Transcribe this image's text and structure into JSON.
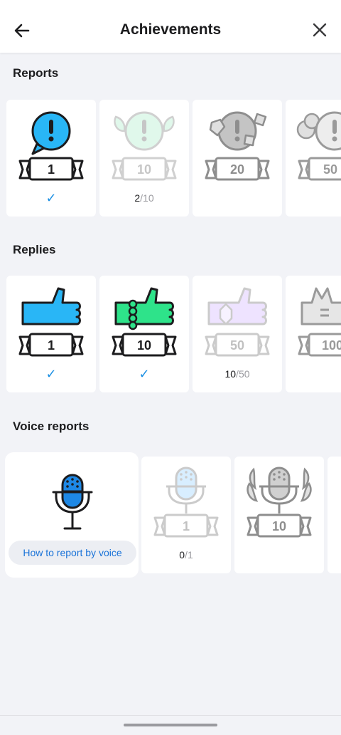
{
  "header": {
    "title": "Achievements",
    "back_icon": "arrow-left-icon",
    "close_icon": "close-icon"
  },
  "sections": [
    {
      "title": "Reports",
      "cards": [
        {
          "badge": "1",
          "state": "done",
          "icon": "speech-bubble-exclamation-icon",
          "color": "#29b6f6"
        },
        {
          "badge": "10",
          "state": "progress",
          "current": "2",
          "total": "10",
          "icon": "laurel-speech-bubble-icon",
          "color": "#c8f3dc"
        },
        {
          "badge": "20",
          "state": "locked",
          "icon": "gem-speech-bubble-icon",
          "color": "#c4c4c4"
        },
        {
          "badge": "50",
          "state": "locked",
          "icon": "cloud-speech-bubble-icon",
          "color": "#e0e0e0"
        }
      ]
    },
    {
      "title": "Replies",
      "cards": [
        {
          "badge": "1",
          "state": "done",
          "icon": "thumbs-up-icon",
          "color": "#29b6f6"
        },
        {
          "badge": "10",
          "state": "done",
          "icon": "thumbs-up-beads-icon",
          "color": "#2ee38a"
        },
        {
          "badge": "50",
          "state": "progress",
          "current": "10",
          "total": "50",
          "icon": "thumbs-up-gem-icon",
          "color": "#e3d2ff"
        },
        {
          "badge": "100",
          "state": "locked",
          "icon": "thumbs-up-crown-icon",
          "color": "#e6e6e6"
        }
      ]
    },
    {
      "title": "Voice reports",
      "howto_label": "How to report by voice",
      "cards": [
        {
          "badge": "1",
          "state": "progress",
          "current": "0",
          "total": "1",
          "icon": "microphone-icon",
          "color": "#bfe3ff"
        },
        {
          "badge": "10",
          "state": "locked",
          "icon": "microphone-laurel-icon",
          "color": "#d8d8d8"
        }
      ]
    }
  ],
  "colors": {
    "accent": "#1a8fe3",
    "background": "#f2f3f7",
    "card": "#ffffff"
  }
}
